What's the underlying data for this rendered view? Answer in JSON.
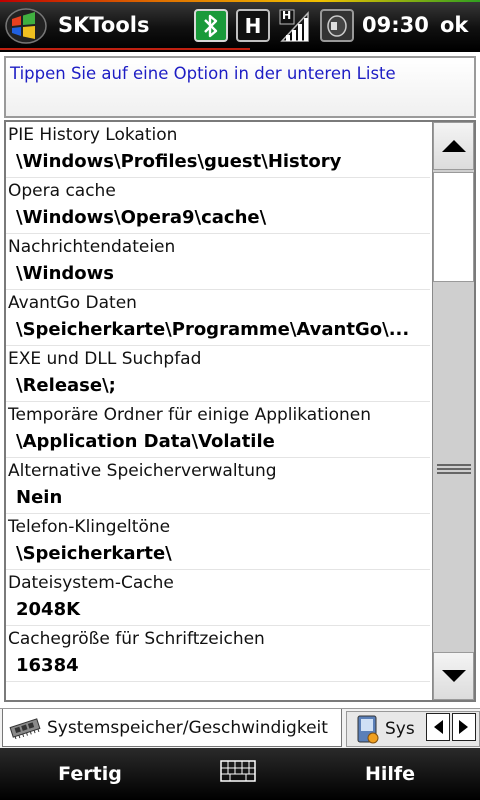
{
  "titlebar": {
    "app_title": "SKTools",
    "clock": "09:30",
    "ok_label": "ok",
    "icons": [
      "windows-start-icon",
      "bluetooth-icon",
      "hspa-icon",
      "signal-icon",
      "volume-icon"
    ],
    "hspa_letter": "H",
    "signal_letter": "H"
  },
  "info": {
    "text": "Tippen Sie auf eine Option in der unteren Liste"
  },
  "list": {
    "items": [
      {
        "label": "PIE History Lokation",
        "value": "\\Windows\\Profiles\\guest\\History"
      },
      {
        "label": "Opera cache",
        "value": "\\Windows\\Opera9\\cache\\"
      },
      {
        "label": "Nachrichtendateien",
        "value": "\\Windows"
      },
      {
        "label": "AvantGo Daten",
        "value": "\\Speicherkarte\\Programme\\AvantGo\\..."
      },
      {
        "label": "EXE und DLL Suchpfad",
        "value": "\\Release\\;"
      },
      {
        "label": "Temporäre Ordner für einige Applikationen",
        "value": "\\Application Data\\Volatile"
      },
      {
        "label": "Alternative Speicherverwaltung",
        "value": "Nein"
      },
      {
        "label": "Telefon-Klingeltöne",
        "value": "\\Speicherkarte\\"
      },
      {
        "label": "Dateisystem-Cache",
        "value": "2048K"
      },
      {
        "label": "Cachegröße für Schriftzeichen",
        "value": "16384"
      }
    ]
  },
  "tabs": {
    "active_label": "Systemspeicher/Geschwindigkeit",
    "second_label": "Sys"
  },
  "softkeys": {
    "left_label": "Fertig",
    "right_label": "Hilfe"
  },
  "colors": {
    "info_text": "#1d1dc4",
    "bluetooth_bg": "#1a9a3a",
    "titlebar_bg": "#000000"
  }
}
